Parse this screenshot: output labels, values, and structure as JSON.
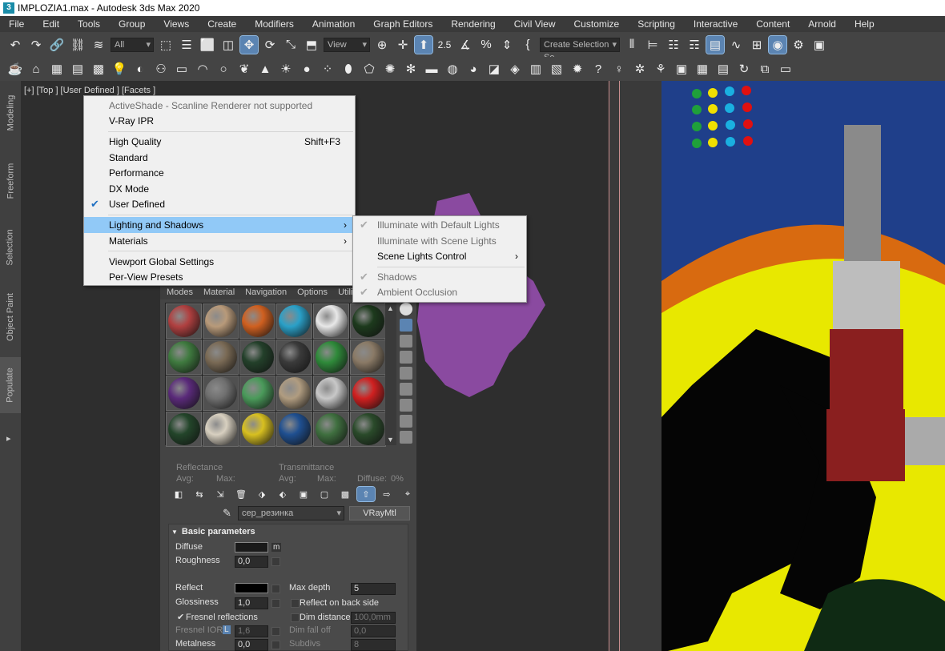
{
  "title_bar": {
    "text": "IMPLOZIA1.max - Autodesk 3ds Max 2020",
    "icon": "3"
  },
  "menu": [
    "File",
    "Edit",
    "Tools",
    "Group",
    "Views",
    "Create",
    "Modifiers",
    "Animation",
    "Graph Editors",
    "Rendering",
    "Civil View",
    "Customize",
    "Scripting",
    "Interactive",
    "Content",
    "Arnold",
    "Help"
  ],
  "toolbar": {
    "filter": "All",
    "ref_coord": "View",
    "selection_set": "Create Selection Se",
    "angle_snap": "2.5"
  },
  "side_tabs": [
    "Modeling",
    "Freeform",
    "Selection",
    "Object Paint",
    "Populate"
  ],
  "viewport": {
    "label": "[+] [Top ] [User Defined ] [Facets ]"
  },
  "context_menu": {
    "items": [
      {
        "label": "ActiveShade - Scanline Renderer not supported",
        "disabled": true
      },
      {
        "label": "V-Ray IPR"
      },
      {
        "label": "High Quality",
        "shortcut": "Shift+F3"
      },
      {
        "label": "Standard"
      },
      {
        "label": "Performance"
      },
      {
        "label": "DX Mode"
      },
      {
        "label": "User Defined",
        "checked": true
      },
      {
        "label": "Lighting and Shadows",
        "submenu": true,
        "highlighted": true
      },
      {
        "label": "Materials",
        "submenu": true
      },
      {
        "label": "Viewport Global Settings"
      },
      {
        "label": "Per-View Presets"
      }
    ],
    "check_glyph": "✔",
    "arrow_glyph": "›"
  },
  "submenu": {
    "items": [
      {
        "label": "Illuminate with Default Lights",
        "disabled": true,
        "checked": true
      },
      {
        "label": "Illuminate with Scene Lights",
        "disabled": true
      },
      {
        "label": "Scene Lights Control",
        "submenu": true
      },
      {
        "label": "Shadows",
        "disabled": true,
        "checked": true
      },
      {
        "label": "Ambient Occlusion",
        "disabled": true,
        "checked": true
      }
    ]
  },
  "material_editor": {
    "tabs": [
      "Modes",
      "Material",
      "Navigation",
      "Options",
      "Utili"
    ],
    "slot_colors": [
      "#b04040",
      "#b89a7a",
      "#d06020",
      "#2aa0c8",
      "#e8e8e8",
      "#1d3a1d",
      "#3f7a3f",
      "#7a6a55",
      "#23402a",
      "#3a3a3a",
      "#2f8a3a",
      "#8a7a66",
      "#5a2a7a",
      "#707070",
      "#4a9a5a",
      "#b09c80",
      "#c8c8c8",
      "#d02020",
      "#23452a",
      "#d8d0c0",
      "#d8c020",
      "#1f4f90",
      "#3f6f3f",
      "#2a4a2a"
    ],
    "reflectance_label": "Reflectance",
    "transmittance_label": "Transmittance",
    "avg_label": "Avg:",
    "max_label": "Max:",
    "diffuse_pct_label": "Diffuse:",
    "diffuse_pct": "0%",
    "material_name": "сер_резинка",
    "material_type": "VRayMtl",
    "section": "Basic parameters",
    "params": {
      "diffuse": "Diffuse",
      "diffuse_map": "m",
      "roughness": "Roughness",
      "roughness_val": "0,0",
      "reflect": "Reflect",
      "max_depth": "Max depth",
      "max_depth_val": "5",
      "glossiness": "Glossiness",
      "glossiness_val": "1,0",
      "reflect_back": "Reflect on back side",
      "fresnel": "Fresnel reflections",
      "dim_distance": "Dim distance",
      "dim_distance_val": "100,0mm",
      "fresnel_ior": "Fresnel IOR",
      "fresnel_ior_lock": "L",
      "fresnel_ior_val": "1,6",
      "dim_falloff": "Dim fall off",
      "dim_falloff_val": "0,0",
      "metalness": "Metalness",
      "metalness_val": "0,0",
      "subdivs": "Subdivs",
      "subdivs_val": "8"
    }
  },
  "colors": {
    "scene_blue": "#1f3f8a",
    "scene_orange": "#d86a10",
    "scene_yellow": "#e8e800",
    "scene_purple": "#8a4aa0",
    "menu_highlight": "#91c9f7"
  }
}
